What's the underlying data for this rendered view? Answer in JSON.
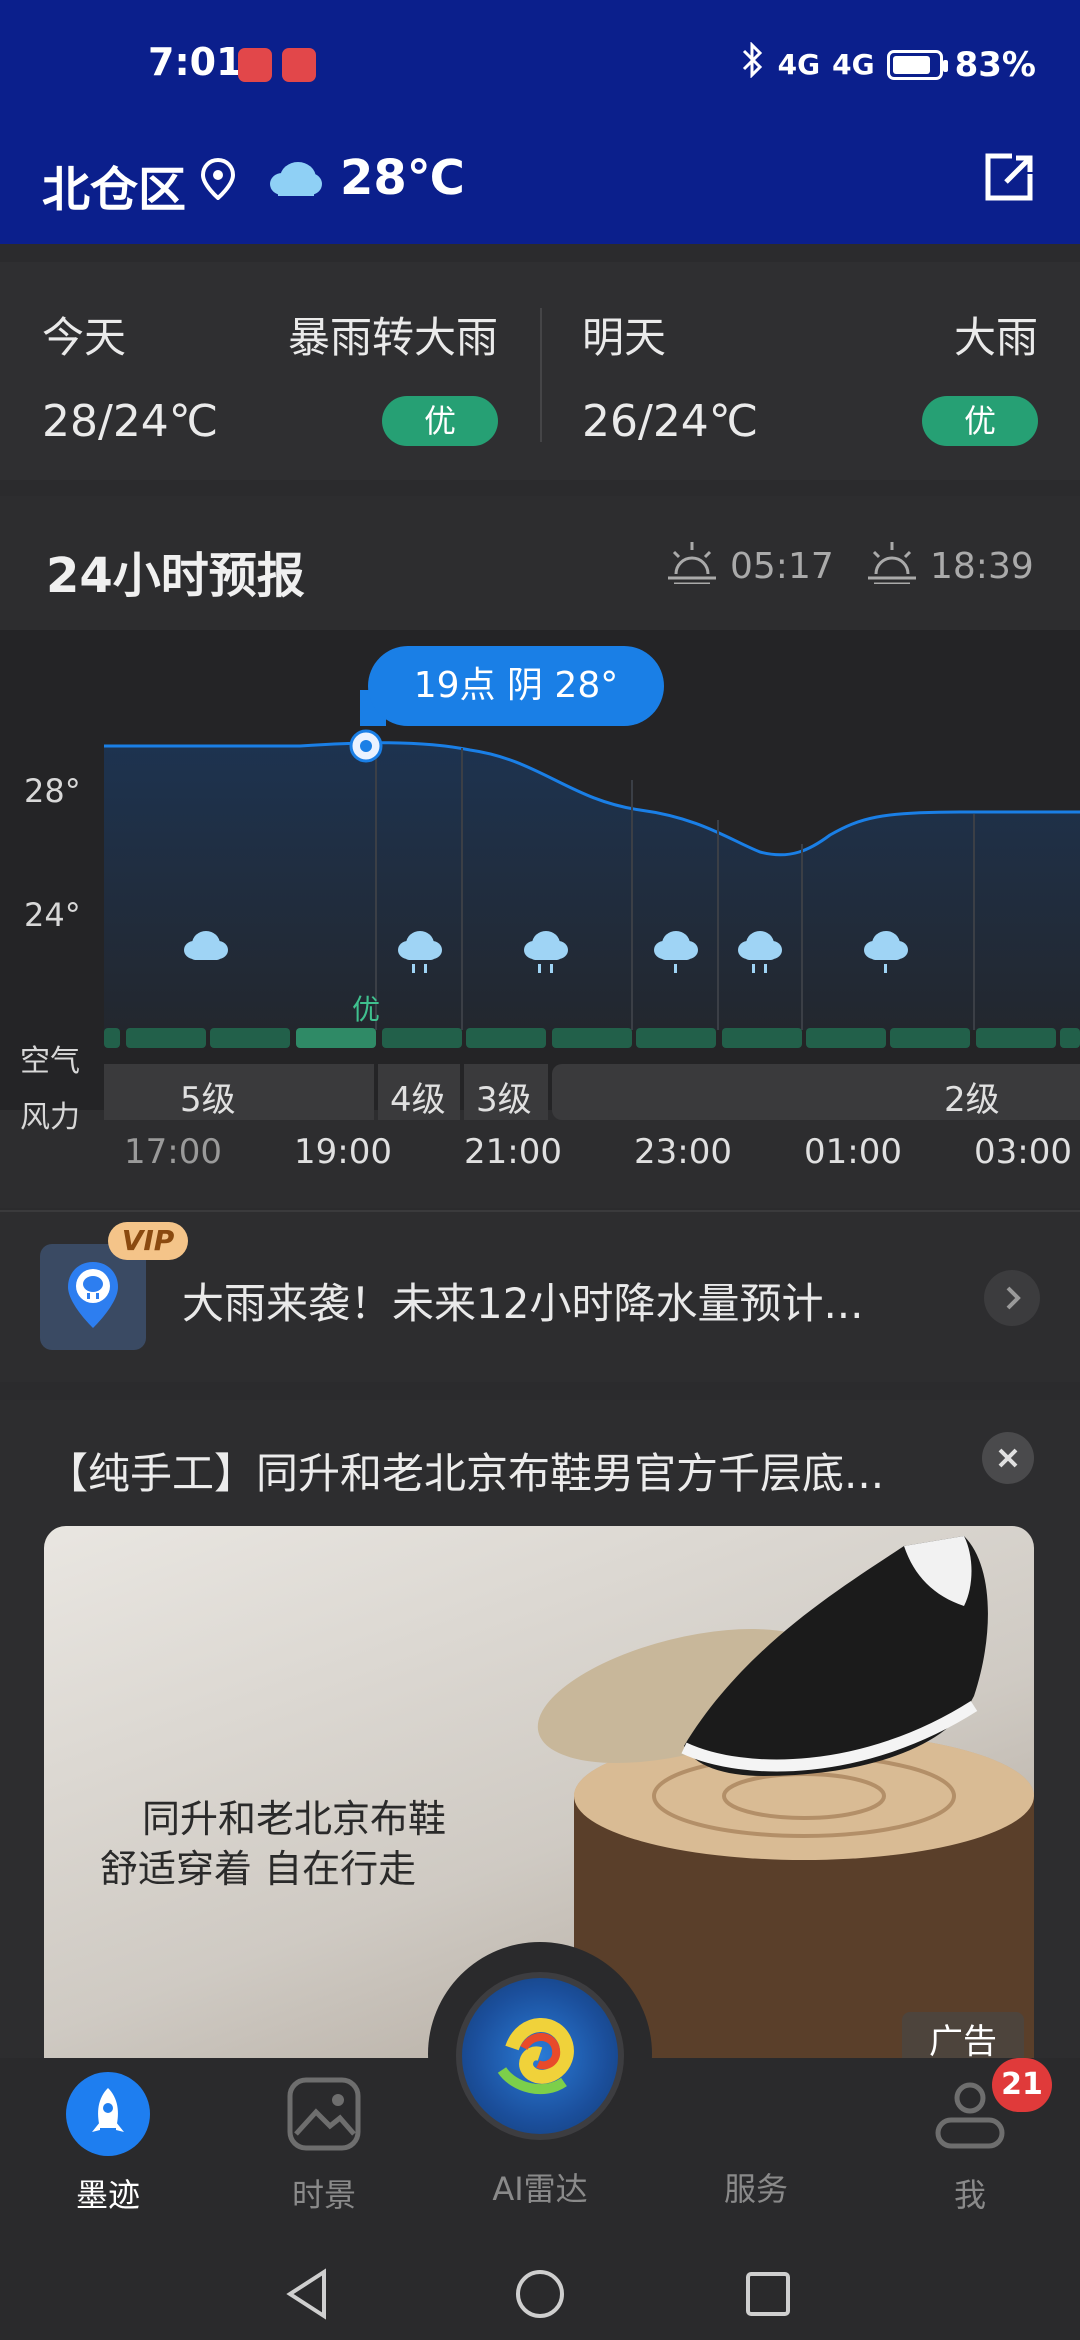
{
  "status": {
    "time": "7:01",
    "signal1": "4G",
    "signal2": "4G",
    "battery": "83%",
    "battery_level": 0.83
  },
  "header": {
    "location": "北仓区",
    "temp": "28℃"
  },
  "today": {
    "label": "今天",
    "condition": "暴雨转大雨",
    "range": "28/24℃",
    "aqi": "优"
  },
  "tomorrow": {
    "label": "明天",
    "condition": "大雨",
    "range": "26/24℃",
    "aqi": "优"
  },
  "forecast": {
    "title": "24小时预报",
    "sunrise": "05:17",
    "sunset": "18:39",
    "tooltip": "19点 阴 28°",
    "y_labels": [
      "28°",
      "24°"
    ],
    "aqi_row_label": "空气",
    "wind_row_label": "风力",
    "aqi_highlight": "优",
    "wind": [
      "5级",
      "4级",
      "3级",
      "2级"
    ],
    "times": [
      "17:00",
      "19:00",
      "21:00",
      "23:00",
      "01:00",
      "03:00"
    ]
  },
  "alert": {
    "vip": "VIP",
    "text": "大雨来袭！未来12小时降水量预计..."
  },
  "ad": {
    "title": "【纯手工】同升和老北京布鞋男官方千层底...",
    "caption1": "同升和老北京布鞋",
    "caption2": "舒适穿着 自在行走",
    "tag": "广告"
  },
  "nav": {
    "items": [
      "墨迹",
      "时景",
      "AI雷达",
      "服务",
      "我"
    ],
    "badge": "21"
  },
  "colors": {
    "header_bg": "#0b1f8c",
    "accent": "#1a7fe6",
    "aqi_green": "#26a074"
  }
}
